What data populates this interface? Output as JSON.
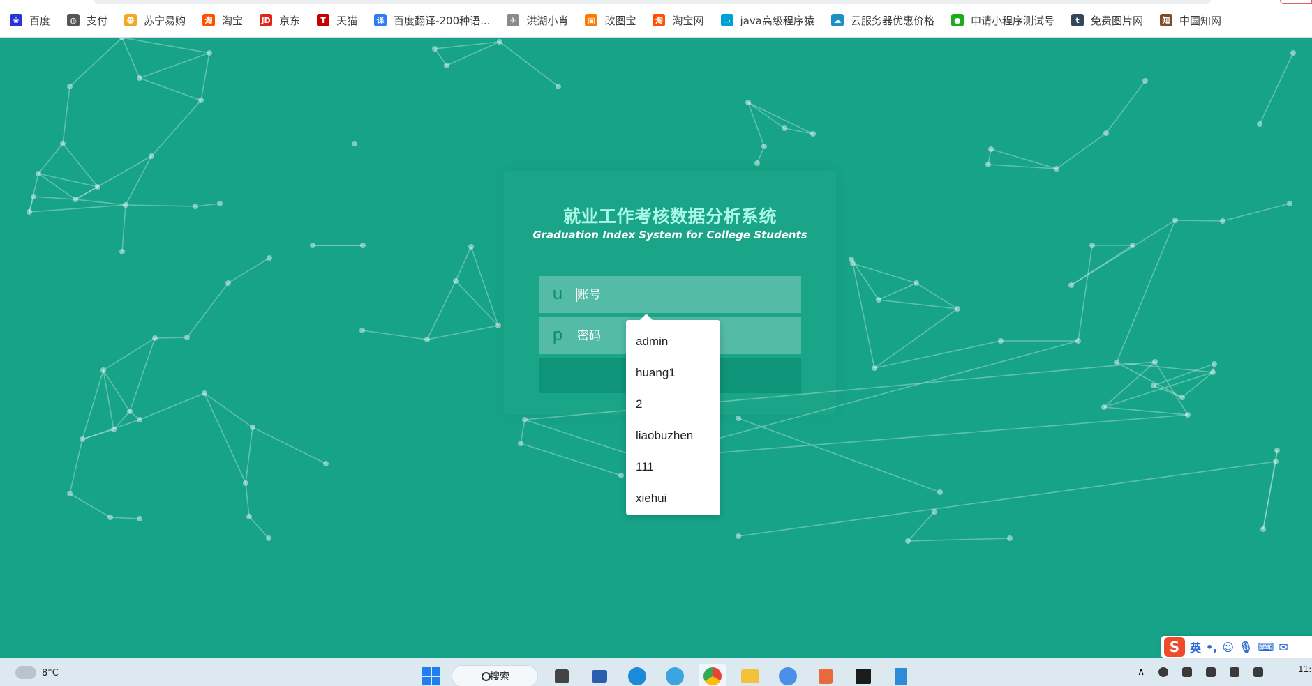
{
  "bookmarks": [
    {
      "label": "百度",
      "icon": "baidu-paw-icon",
      "color": "#2932e1",
      "glyph": "❀"
    },
    {
      "label": "支付",
      "icon": "globe-icon",
      "color": "#555555",
      "glyph": "◍"
    },
    {
      "label": "苏宁易购",
      "icon": "suning-lion-icon",
      "color": "#f5a623",
      "glyph": "☻"
    },
    {
      "label": "淘宝",
      "icon": "taobao-icon",
      "color": "#ff5000",
      "glyph": "淘"
    },
    {
      "label": "京东",
      "icon": "jd-icon",
      "color": "#e1251b",
      "glyph": "JD"
    },
    {
      "label": "天猫",
      "icon": "tmall-icon",
      "color": "#c40000",
      "glyph": "T"
    },
    {
      "label": "百度翻译-200种语...",
      "icon": "baidu-translate-icon",
      "color": "#2f7cf6",
      "glyph": "译"
    },
    {
      "label": "洪湖小肖",
      "icon": "bird-icon",
      "color": "#8a8a8a",
      "glyph": "✈"
    },
    {
      "label": "改图宝",
      "icon": "gaitubao-icon",
      "color": "#ff7a00",
      "glyph": "▣"
    },
    {
      "label": "淘宝网",
      "icon": "taobao-icon",
      "color": "#ff5000",
      "glyph": "淘"
    },
    {
      "label": "java高级程序猿",
      "icon": "bilibili-tv-icon",
      "color": "#00a1d6",
      "glyph": "▭"
    },
    {
      "label": "云服务器优惠价格",
      "icon": "cloud-icon",
      "color": "#1e90c8",
      "glyph": "☁"
    },
    {
      "label": "申请小程序测试号",
      "icon": "wechat-icon",
      "color": "#1aad19",
      "glyph": "●"
    },
    {
      "label": "免费图片网",
      "icon": "tumblr-icon",
      "color": "#36465d",
      "glyph": "t"
    },
    {
      "label": "中国知网",
      "icon": "cnki-icon",
      "color": "#7b4b2a",
      "glyph": "知"
    }
  ],
  "login": {
    "title": "就业工作考核数据分析系统",
    "subtitle": "Graduation Index System for College Students",
    "username_prefix": "u",
    "username_placeholder": "账号",
    "password_prefix": "p",
    "password_placeholder": "密码"
  },
  "autocomplete": [
    "admin",
    "huang1",
    "2",
    "liaobuzhen",
    "111",
    "xiehui"
  ],
  "ime": {
    "lang": "英"
  },
  "taskbar": {
    "weather_temp": "8°C",
    "search_label": "搜索",
    "clock_time": "11:"
  }
}
